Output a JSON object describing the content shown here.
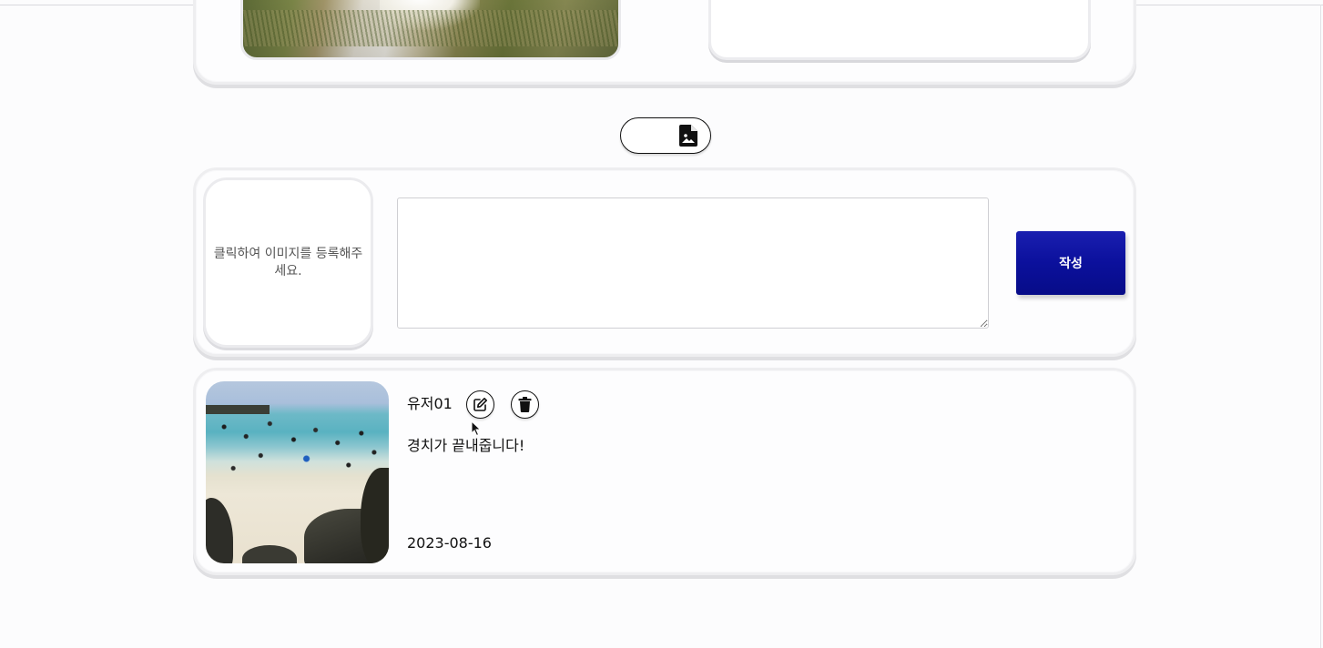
{
  "colors": {
    "submit_button": "#0b109c",
    "card_border": "#eeeef0",
    "page_background": "#fcfcfd"
  },
  "toolbar": {
    "attach_icon": "file-image-icon"
  },
  "composer": {
    "image_placeholder": "클릭하여 이미지를 등록해주세요.",
    "text_value": "",
    "submit_label": "작성"
  },
  "post": {
    "username": "유저01",
    "edit_icon": "edit-icon",
    "delete_icon": "trash-icon",
    "content": "경치가 끝내줍니다!",
    "date": "2023-08-16"
  }
}
